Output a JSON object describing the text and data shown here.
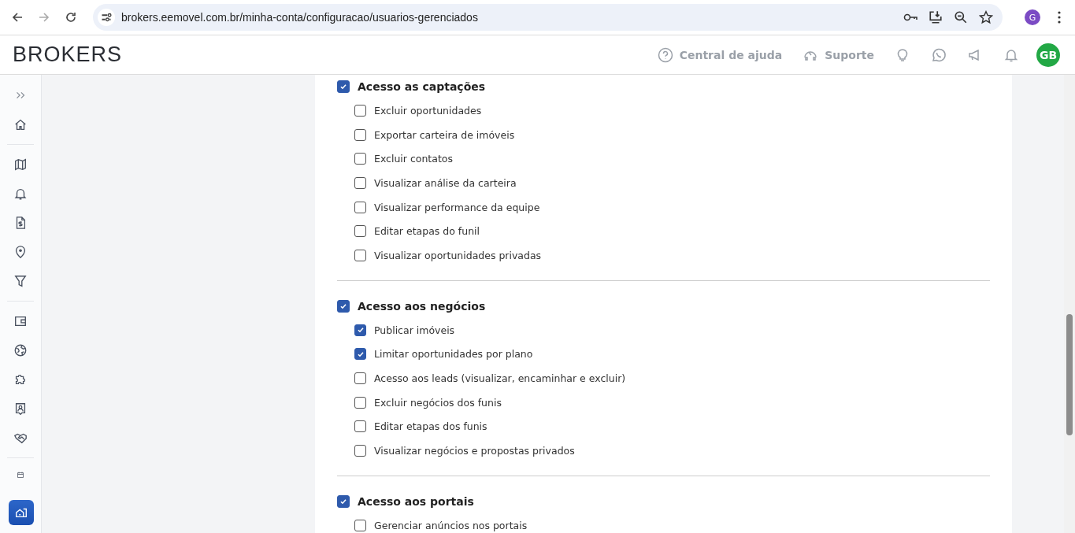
{
  "browser": {
    "url": "brokers.eemovel.com.br/minha-conta/configuracao/usuarios-gerenciados",
    "profile": "G"
  },
  "header": {
    "logo": "BROKERS",
    "help": "Central de ajuda",
    "support": "Suporte",
    "avatar": "GB"
  },
  "sections": [
    {
      "title": "Acesso as captações",
      "checked": true,
      "items": [
        {
          "label": "Excluir oportunidades",
          "checked": false
        },
        {
          "label": "Exportar carteira de imóveis",
          "checked": false
        },
        {
          "label": "Excluir contatos",
          "checked": false
        },
        {
          "label": "Visualizar análise da carteira",
          "checked": false
        },
        {
          "label": "Visualizar performance da equipe",
          "checked": false
        },
        {
          "label": "Editar etapas do funil",
          "checked": false
        },
        {
          "label": "Visualizar oportunidades privadas",
          "checked": false
        }
      ]
    },
    {
      "title": "Acesso aos negócios",
      "checked": true,
      "items": [
        {
          "label": "Publicar imóveis",
          "checked": true
        },
        {
          "label": "Limitar oportunidades por plano",
          "checked": true
        },
        {
          "label": "Acesso aos leads (visualizar, encaminhar e excluir)",
          "checked": false
        },
        {
          "label": "Excluir negócios dos funis",
          "checked": false
        },
        {
          "label": "Editar etapas dos funis",
          "checked": false
        },
        {
          "label": "Visualizar negócios e propostas privados",
          "checked": false
        }
      ]
    },
    {
      "title": "Acesso aos portais",
      "checked": true,
      "items": [
        {
          "label": "Gerenciar anúncios nos portais",
          "checked": false
        }
      ]
    }
  ]
}
